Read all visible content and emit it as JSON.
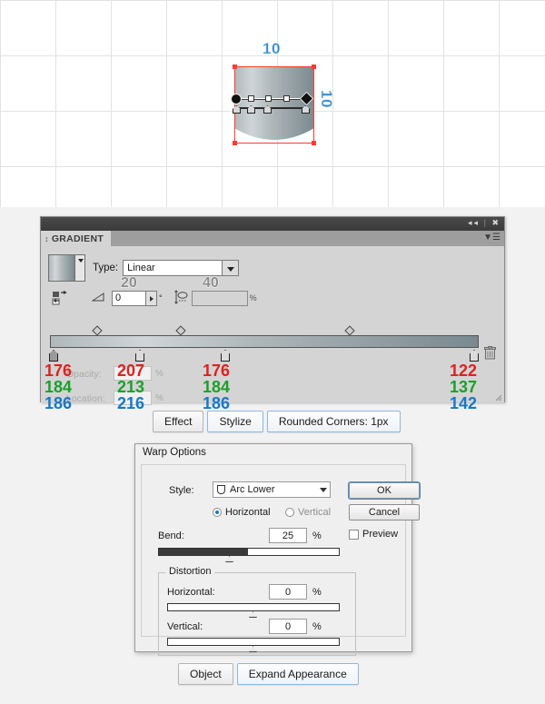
{
  "canvas": {
    "dimension_top": "10",
    "dimension_right": "10",
    "shape_name": "rounded-rectangle-arc-lower"
  },
  "gradient_panel": {
    "tab_label": "GRADIENT",
    "titlebar": {
      "collapse_icon": "collapse-icon",
      "close_icon": "close-icon"
    },
    "menu_icon": "panel-menu-icon",
    "type_label": "Type:",
    "type_value": "Linear",
    "reverse_icon": "reverse-gradient-icon",
    "angle_icon": "angle-icon",
    "angle_value": "0",
    "degree_symbol": "°",
    "aspect_icon": "aspect-ratio-icon",
    "aspect_value": "",
    "percent_symbol": "%",
    "opacity_label": "Opacity:",
    "opacity_value": "",
    "location_label": "Location:",
    "location_value": "",
    "delete_stop_icon": "trash-icon",
    "resize_icon": "resize-grip-icon",
    "annotations": {
      "a20": "20",
      "a40": "40"
    },
    "stops": [
      {
        "r": "176",
        "g": "184",
        "b": "186",
        "location_pct": 0
      },
      {
        "r": "207",
        "g": "213",
        "b": "216",
        "location_pct": 21
      },
      {
        "r": "176",
        "g": "184",
        "b": "186",
        "location_pct": 41
      },
      {
        "r": "122",
        "g": "137",
        "b": "142",
        "location_pct": 100
      }
    ],
    "midpoints_pct": [
      11,
      30,
      71
    ]
  },
  "breadcrumb_top": {
    "items": [
      {
        "label": "Effect",
        "highlight": false
      },
      {
        "label": "Stylize",
        "highlight": true
      },
      {
        "label": "Rounded Corners: 1px",
        "highlight": true
      }
    ]
  },
  "breadcrumb_bottom": {
    "items": [
      {
        "label": "Object",
        "highlight": false
      },
      {
        "label": "Expand Appearance",
        "highlight": true
      }
    ]
  },
  "warp_dialog": {
    "title": "Warp Options",
    "style_label": "Style:",
    "style_value": "Arc Lower",
    "style_glyph": "arc-lower-icon",
    "orientation": {
      "horizontal_label": "Horizontal",
      "vertical_label": "Vertical",
      "selected": "Horizontal"
    },
    "bend_label": "Bend:",
    "bend_value": "25",
    "bend_percent": "%",
    "distortion_legend": "Distortion",
    "distortion_horizontal_label": "Horizontal:",
    "distortion_horizontal_value": "0",
    "distortion_horizontal_percent": "%",
    "distortion_vertical_label": "Vertical:",
    "distortion_vertical_value": "0",
    "distortion_vertical_percent": "%",
    "ok_label": "OK",
    "cancel_label": "Cancel",
    "preview_label": "Preview",
    "preview_checked": false
  },
  "colors": {
    "accent_blue": "#2f86d0",
    "selection_red": "#ff3a33",
    "panel_gray": "#d4d4d4",
    "value_red": "#e02020",
    "value_green": "#1aa02a",
    "value_blue": "#1878c8"
  }
}
